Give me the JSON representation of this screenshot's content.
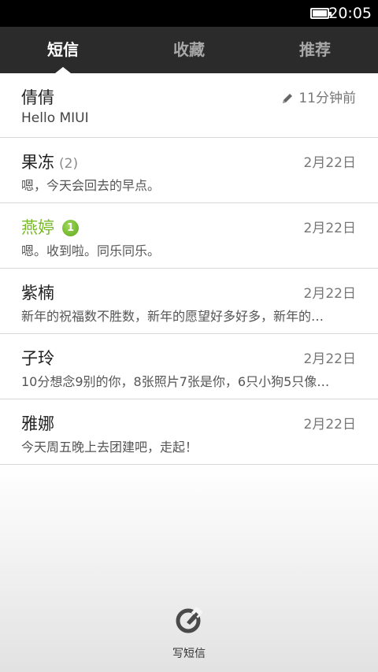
{
  "status_bar": {
    "time": "20:05"
  },
  "tabs": [
    {
      "label": "短信",
      "active": true
    },
    {
      "label": "收藏",
      "active": false
    },
    {
      "label": "推荐",
      "active": false
    }
  ],
  "conversations": [
    {
      "contact": "倩倩",
      "preview": "Hello MIUI",
      "time": "11分钟前",
      "draft": true
    },
    {
      "contact": "果冻",
      "count": "(2)",
      "preview": "嗯，今天会回去的早点。",
      "time": "2月22日"
    },
    {
      "contact": "燕婷",
      "unread_badge": "1",
      "preview": "嗯。收到啦。同乐同乐。",
      "time": "2月22日"
    },
    {
      "contact": "紫楠",
      "preview": "新年的祝福数不胜数，新年的愿望好多好多，新年的…",
      "time": "2月22日"
    },
    {
      "contact": "子玲",
      "preview": "10分想念9别的你，8张照片7张是你，6只小狗5只像…",
      "time": "2月22日"
    },
    {
      "contact": "雅娜",
      "preview": "今天周五晚上去团建吧，走起！",
      "time": "2月22日"
    }
  ],
  "compose": {
    "label": "写短信"
  },
  "colors": {
    "unread_name": "#7ab928",
    "tab_bar": "#2b2b2b",
    "badge": "#6cb624"
  }
}
